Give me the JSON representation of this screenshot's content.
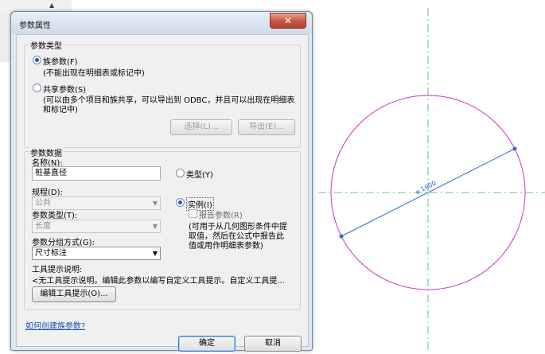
{
  "dialog": {
    "title": "参数属性",
    "close_icon": "✕"
  },
  "param_type_group": {
    "legend": "参数类型",
    "family_param_label": "族参数(F)",
    "family_param_desc": "(不能出现在明细表或标记中)",
    "shared_param_label": "共享参数(S)",
    "shared_param_desc_line1": "(可以由多个项目和族共享，可以导出到 ODBC，并且可以出现在明细表",
    "shared_param_desc_line2": "和标记中)",
    "select_button": "选择(L)...",
    "export_button": "导出(E)..."
  },
  "param_data_group": {
    "legend": "参数数据",
    "name_label": "名称(N):",
    "name_value": "桩基直径",
    "type_radio_label": "类型(Y)",
    "discipline_label": "规程(D):",
    "discipline_value": "公共",
    "instance_radio_label": "实例(I)",
    "param_type_label": "参数类型(T):",
    "param_type_value": "长度",
    "report_param_label": "报告参数(R)",
    "report_desc_line1": "(可用于从几何图形条件中提",
    "report_desc_line2": "取值，然后在公式中报告此",
    "report_desc_line3": "值或用作明细表参数)",
    "group_by_label": "参数分组方式(G):",
    "group_by_value": "尺寸标注",
    "tooltip_label": "工具提示说明:",
    "tooltip_value": "<无工具提示说明。编辑此参数以编写自定义工具提示。自定义工具提...",
    "edit_tooltip_button": "编辑工具提示(O)..."
  },
  "help_link": "如何创建族参数?",
  "ok_button": "确定",
  "cancel_button": "取消",
  "canvas": {
    "dimension_text": "⌀ 1600",
    "circle_color": "#cc33cc",
    "dimension_color": "#2f6bd1",
    "reference_line_color": "#66cc66"
  }
}
